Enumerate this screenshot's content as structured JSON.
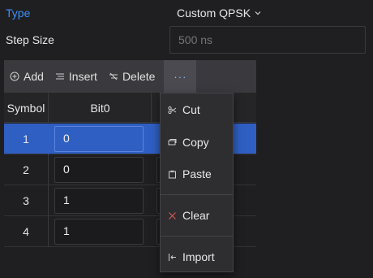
{
  "form": {
    "type_label": "Type",
    "type_value": "Custom QPSK",
    "step_label": "Step Size",
    "step_placeholder": "500 ns"
  },
  "toolbar": {
    "add": "Add",
    "insert": "Insert",
    "delete": "Delete",
    "more": "···"
  },
  "table": {
    "columns": [
      "Symbol",
      "Bit0"
    ],
    "rows": [
      {
        "symbol": "1",
        "bit0": "0",
        "selected": true
      },
      {
        "symbol": "2",
        "bit0": "0",
        "selected": false
      },
      {
        "symbol": "3",
        "bit0": "1",
        "selected": false
      },
      {
        "symbol": "4",
        "bit0": "1",
        "selected": false
      }
    ]
  },
  "menu": {
    "cut": "Cut",
    "copy": "Copy",
    "paste": "Paste",
    "clear": "Clear",
    "import": "Import"
  },
  "colors": {
    "accent": "#3d8ff5",
    "selection": "#2f5fc2",
    "clear_icon": "#d9534f"
  }
}
